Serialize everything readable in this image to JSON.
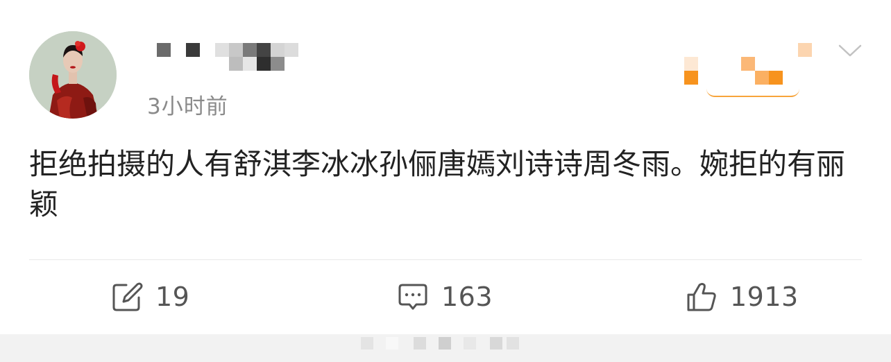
{
  "post": {
    "author": {
      "avatar": "avatar-photo",
      "name_redacted": true
    },
    "timestamp": "3小时前",
    "text": "拒绝拍摄的人有舒淇李冰冰孙俪唐嫣刘诗诗周冬雨。婉拒的有丽颖",
    "menu_icon": "chevron-down-icon",
    "actions": {
      "repost": {
        "icon": "repost-icon",
        "count": "19"
      },
      "comment": {
        "icon": "comment-icon",
        "count": "163"
      },
      "like": {
        "icon": "like-icon",
        "count": "1913"
      }
    }
  },
  "colors": {
    "text": "#222222",
    "secondary": "#8a8a8a",
    "count": "#555555",
    "badge_orange": "#f7931e",
    "divider": "#e8e8e8"
  }
}
